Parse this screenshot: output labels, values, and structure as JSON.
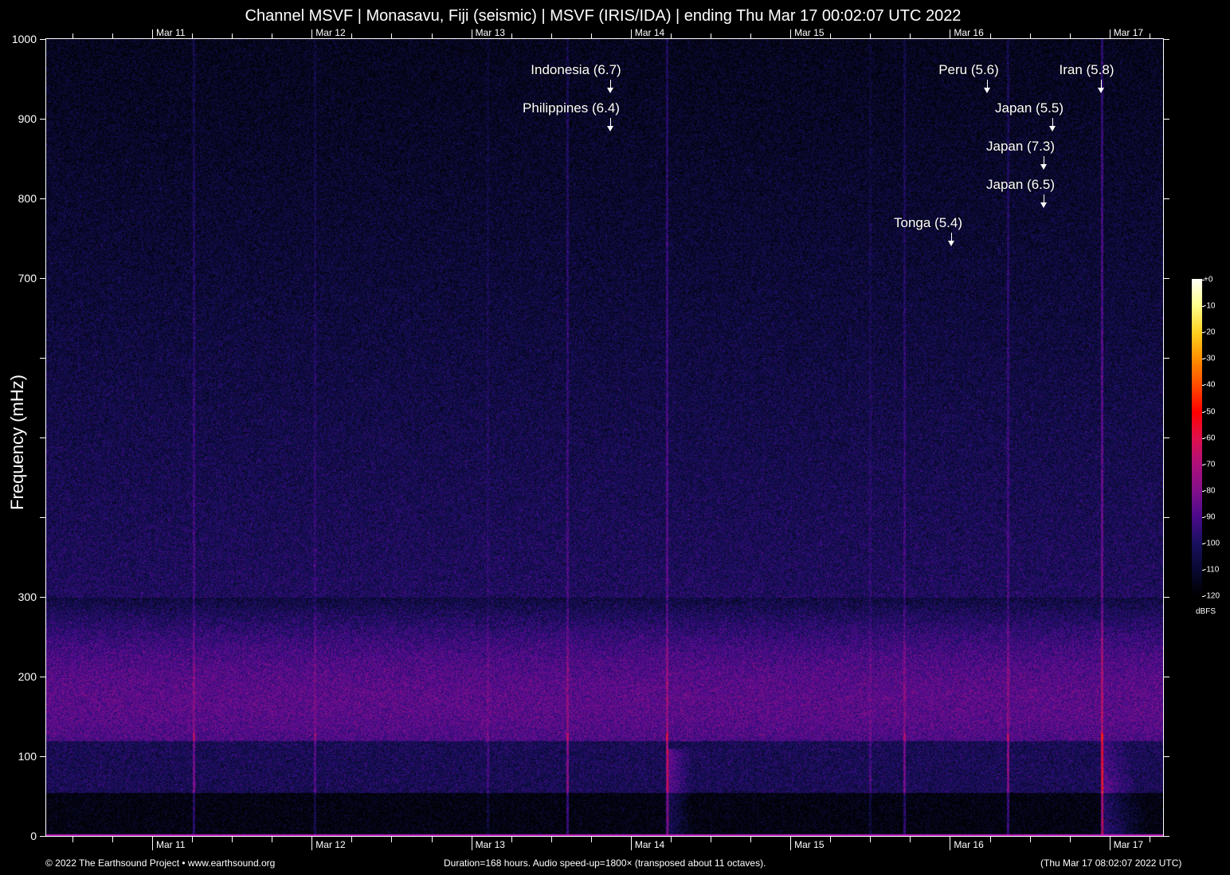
{
  "title": "Channel MSVF | Monasavu, Fiji (seismic) | MSVF (IRIS/IDA) | ending Thu Mar 17 00:02:07 UTC 2022",
  "chart_data": {
    "type": "heatmap",
    "title": "Channel MSVF | Monasavu, Fiji (seismic) | MSVF (IRIS/IDA) | ending Thu Mar 17 00:02:07 UTC 2022",
    "ylabel": "Frequency (mHz)",
    "xlabel": "",
    "ylim": [
      0,
      1000
    ],
    "duration_hours": 168,
    "yticks": [
      "0",
      "100",
      "200",
      "300",
      "700",
      "800",
      "900",
      "1000"
    ],
    "ytick_values": [
      0,
      100,
      200,
      300,
      700,
      800,
      900,
      1000
    ],
    "xticks": [
      "Mar 11",
      "Mar 12",
      "Mar 13",
      "Mar 14",
      "Mar 15",
      "Mar 16",
      "Mar 17"
    ],
    "colorbar": {
      "label": "dBFS",
      "ticks": [
        "+0",
        "-10",
        "-20",
        "-30",
        "-40",
        "-50",
        "-60",
        "-70",
        "-80",
        "-90",
        "-100",
        "-110",
        "-120"
      ],
      "range": [
        -120,
        0
      ]
    },
    "annotations": [
      {
        "label": "Indonesia (6.7)"
      },
      {
        "label": "Philippines (6.4)"
      },
      {
        "label": "Peru (5.6)"
      },
      {
        "label": "Iran (5.8)"
      },
      {
        "label": "Japan (5.5)"
      },
      {
        "label": "Japan (7.3)"
      },
      {
        "label": "Japan (6.5)"
      },
      {
        "label": "Tonga (5.4)"
      }
    ]
  },
  "footer": {
    "left": "© 2022 The Earthsound Project • www.earthsound.org",
    "center": "Duration=168 hours. Audio speed-up=1800× (transposed about 11 octaves).",
    "right": "(Thu Mar 17 08:02:07 2022 UTC)"
  }
}
